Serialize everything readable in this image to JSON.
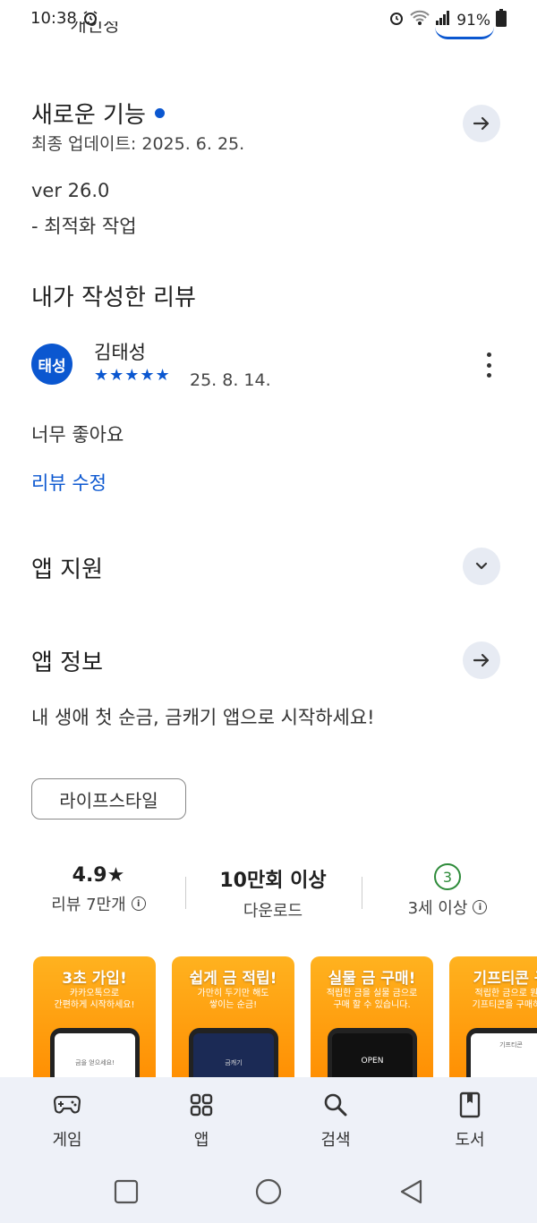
{
  "status_bar": {
    "time": "10:38",
    "battery": "91%"
  },
  "whats_new": {
    "title": "새로운 기능",
    "updated": "최종 업데이트: 2025. 6. 25.",
    "version": "ver 26.0",
    "notes": "- 최적화 작업"
  },
  "my_review": {
    "title": "내가 작성한 리뷰",
    "avatar_text": "태성",
    "name": "김태성",
    "stars": "★★★★★",
    "date": "25. 8. 14.",
    "text": "너무 좋아요",
    "edit_label": "리뷰 수정"
  },
  "app_support": {
    "title": "앱 지원"
  },
  "app_info": {
    "title": "앱 정보",
    "description": "내 생애 첫 순금, 금캐기 앱으로 시작하세요!",
    "category": "라이프스타일"
  },
  "stats": {
    "rating": "4.9★",
    "reviews": "리뷰 7만개",
    "downloads_value": "10만회 이상",
    "downloads_label": "다운로드",
    "age_badge": "3",
    "age_label": "3세 이상"
  },
  "screenshots": [
    {
      "title": "3초 가입!",
      "sub": "카카오톡으로\n간편하게 시작하세요!",
      "screen": "금을 얻으세요!"
    },
    {
      "title": "쉽게 금 적립!",
      "sub": "가만히 두기만 해도\n쌓이는 순금!",
      "screen": "금캐기"
    },
    {
      "title": "실물 금 구매!",
      "sub": "적립한 금을 실물 금으로\n구매 할 수 있습니다.",
      "screen": "OPEN"
    },
    {
      "title": "기프티콘 구",
      "sub": "적립한 금으로 원하\n기프티콘을 구매하세",
      "screen": "기프티콘"
    }
  ],
  "bottom_nav": [
    {
      "label": "게임",
      "icon": "gamepad-icon"
    },
    {
      "label": "앱",
      "icon": "apps-grid-icon"
    },
    {
      "label": "검색",
      "icon": "search-icon"
    },
    {
      "label": "도서",
      "icon": "book-icon"
    }
  ],
  "colors": {
    "accent": "#0b57d0",
    "nav_bg": "#eef1f8",
    "age_green": "#2e8b3a"
  }
}
